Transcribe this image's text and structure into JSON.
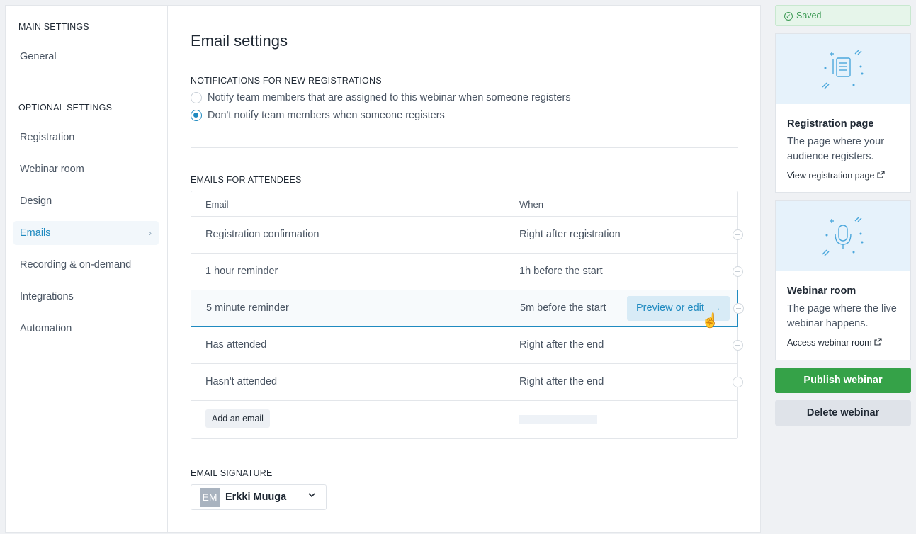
{
  "sidebar": {
    "main_heading": "MAIN SETTINGS",
    "general": "General",
    "optional_heading": "OPTIONAL SETTINGS",
    "items": [
      {
        "label": "Registration"
      },
      {
        "label": "Webinar room"
      },
      {
        "label": "Design"
      },
      {
        "label": "Emails"
      },
      {
        "label": "Recording & on-demand"
      },
      {
        "label": "Integrations"
      },
      {
        "label": "Automation"
      }
    ]
  },
  "main": {
    "title": "Email settings",
    "notifications_heading": "NOTIFICATIONS FOR NEW REGISTRATIONS",
    "notify_option_1": "Notify team members that are assigned to this webinar when someone registers",
    "notify_option_2": "Don't notify team members when someone registers",
    "attendees_heading": "EMAILS FOR ATTENDEES",
    "table": {
      "col_email": "Email",
      "col_when": "When",
      "rows": [
        {
          "email": "Registration confirmation",
          "when": "Right after registration"
        },
        {
          "email": "1 hour reminder",
          "when": "1h before the start"
        },
        {
          "email": "5 minute reminder",
          "when": "5m before the start"
        },
        {
          "email": "Has attended",
          "when": "Right after the end"
        },
        {
          "email": "Hasn't attended",
          "when": "Right after the end"
        }
      ],
      "preview_label": "Preview or edit",
      "add_label": "Add an email"
    },
    "signature_heading": "EMAIL SIGNATURE",
    "signature_initials": "EM",
    "signature_name": "Erkki Muuga"
  },
  "right": {
    "saved": "Saved",
    "registration_card": {
      "title": "Registration page",
      "desc": "The page where your audience registers.",
      "link": "View registration page"
    },
    "room_card": {
      "title": "Webinar room",
      "desc": "The page where the live webinar happens.",
      "link": "Access webinar room"
    },
    "publish": "Publish webinar",
    "delete": "Delete webinar"
  },
  "colors": {
    "accent": "#1f8ac0",
    "publish": "#35a248",
    "saved": "#3c9a54"
  }
}
